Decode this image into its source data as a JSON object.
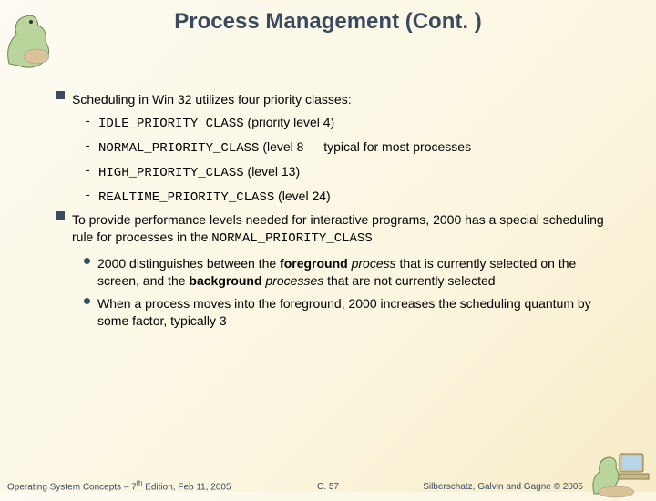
{
  "title": "Process Management (Cont. )",
  "bullets": {
    "b1": "Scheduling in Win 32 utilizes four priority classes:",
    "b1a_code": "IDLE_PRIORITY_CLASS",
    "b1a_rest": " (priority level 4)",
    "b1b_code": "NORMAL_PRIORITY_CLASS",
    "b1b_rest": " (level 8 — typical for most processes",
    "b1c_code": "HIGH_PRIORITY_CLASS",
    "b1c_rest": " (level 13)",
    "b1d_code": "REALTIME_PRIORITY_CLASS",
    "b1d_rest": " (level 24)",
    "b2_pre": "To provide performance levels needed for interactive programs, 2000 has a special scheduling rule for processes in the ",
    "b2_code": "NORMAL_PRIORITY_CLASS",
    "b3a_pre": "2000 distinguishes between the ",
    "b3a_fg": "foreground",
    "b3a_mid": " process",
    "b3a_mid2": " that is currently selected on the screen, and the ",
    "b3a_bg": "background",
    "b3a_mid3": " processes",
    "b3a_end": " that are not currently selected",
    "b3b": "When a process moves into the foreground, 2000 increases the scheduling quantum by some factor, typically 3"
  },
  "footer": {
    "left_a": "Operating System Concepts – 7",
    "left_b": " Edition, Feb 11, 2005",
    "center": "C. 57",
    "right": "Silberschatz, Galvin and Gagne © 2005"
  }
}
